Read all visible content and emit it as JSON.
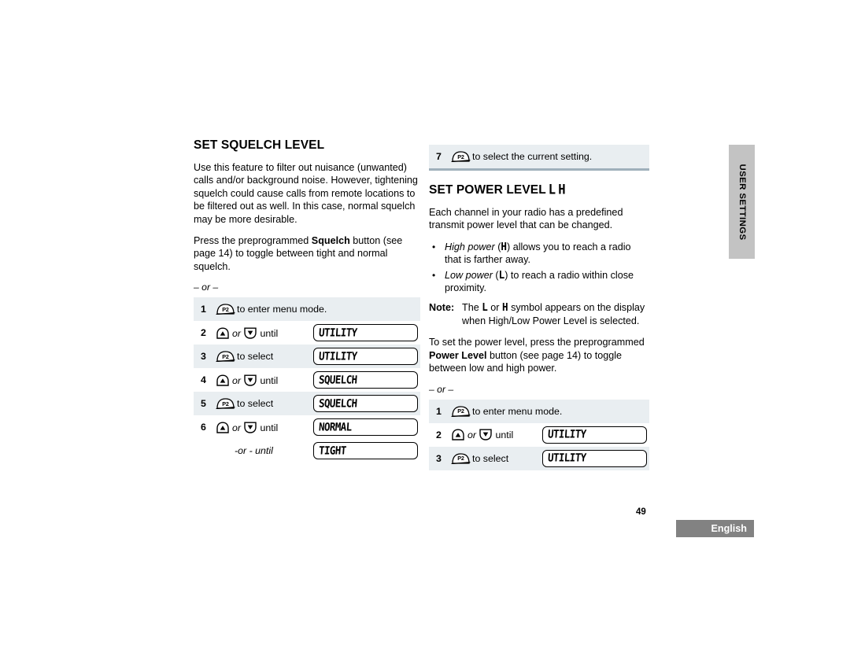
{
  "left_column": {
    "title": "SET SQUELCH LEVEL",
    "paragraph_1": "Use this feature to filter out nuisance (unwanted) calls and/or background noise. However, tightening squelch could cause calls from remote locations to be filtered out as well. In this case, normal squelch may be more desirable.",
    "paragraph_2_a": "Press the preprogrammed ",
    "paragraph_2_bold": "Squelch",
    "paragraph_2_b": " button (see page 14) to toggle between tight and normal squelch.",
    "or_separator": "– or –",
    "steps": [
      {
        "num": "1",
        "button": "P2",
        "action": "to enter menu mode.",
        "display": ""
      },
      {
        "num": "2",
        "button": "updown",
        "action_pre": "",
        "or_word": "or",
        "action": "until",
        "display": "UTILITY"
      },
      {
        "num": "3",
        "button": "P2",
        "action": "to select",
        "display": "UTILITY"
      },
      {
        "num": "4",
        "button": "updown",
        "or_word": "or",
        "action": "until",
        "display": "SQUELCH"
      },
      {
        "num": "5",
        "button": "P2",
        "action": "to select",
        "display": "SQUELCH"
      },
      {
        "num": "6",
        "button": "updown",
        "or_word": "or",
        "action": "until",
        "display": "NORMAL"
      },
      {
        "num": "",
        "button": "none",
        "action": "-or - until",
        "display": "TIGHT"
      }
    ]
  },
  "right_column": {
    "step_seven": {
      "num": "7",
      "button": "P2",
      "action": "to select the current setting."
    },
    "title_text": "SET POWER LEVEL",
    "title_symbol_low": "L",
    "title_symbol_high": "H",
    "paragraph_1": "Each channel in your radio has a predefined transmit power level that can be changed.",
    "bullets": [
      {
        "italic": "High power",
        "pre": " (",
        "symbol": "H",
        "post": ") allows you to reach a radio that is farther away."
      },
      {
        "italic": "Low power",
        "pre": " (",
        "symbol": "L",
        "post": ") to reach a radio within close proximity."
      }
    ],
    "note_label": "Note:",
    "note_a": "The ",
    "note_symbol_1": "L",
    "note_b": " or ",
    "note_symbol_2": "H",
    "note_c": " symbol appears on the display when High/Low Power Level is selected.",
    "paragraph_2_a": "To set the power level, press the preprogrammed ",
    "paragraph_2_bold": "Power Level",
    "paragraph_2_b": " button (see page 14) to toggle between low and high power.",
    "or_separator": "– or –",
    "steps": [
      {
        "num": "1",
        "button": "P2",
        "action": "to enter menu mode.",
        "display": ""
      },
      {
        "num": "2",
        "button": "updown",
        "or_word": "or",
        "action": "until",
        "display": "UTILITY"
      },
      {
        "num": "3",
        "button": "P2",
        "action": "to select",
        "display": "UTILITY"
      }
    ]
  },
  "side_tab": {
    "label": "USER SETTINGS",
    "color": "#c3c3c3"
  },
  "footer": {
    "page_number": "49",
    "language": "English",
    "badge_color": "#828282"
  },
  "icons": {
    "p2_button": "p2-button-icon",
    "up_button": "up-arrow-button-icon",
    "down_button": "down-arrow-button-icon"
  },
  "colors": {
    "row_shade": "#e9eef1",
    "rule": "#9fb0bb"
  }
}
